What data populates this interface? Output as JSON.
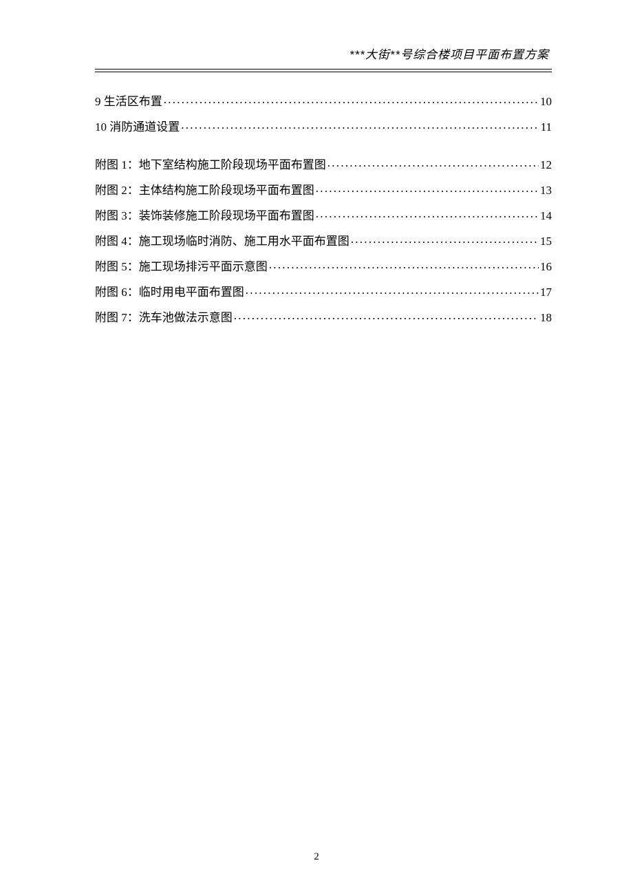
{
  "header": {
    "title": "***大街**号综合楼项目平面布置方案"
  },
  "toc": {
    "sections": [
      {
        "label": "9 生活区布置",
        "page": "10"
      },
      {
        "label": "10 消防通道设置",
        "page": "11"
      }
    ],
    "appendices": [
      {
        "label": "附图 1：地下室结构施工阶段现场平面布置图",
        "page": "12"
      },
      {
        "label": "附图 2：主体结构施工阶段现场平面布置图",
        "page": "13"
      },
      {
        "label": "附图 3：装饰装修施工阶段现场平面布置图",
        "page": "14"
      },
      {
        "label": "附图 4：施工现场临时消防、施工用水平面布置图",
        "page": "15"
      },
      {
        "label": "附图 5：施工现场排污平面示意图",
        "page": "16"
      },
      {
        "label": "附图 6：临时用电平面布置图",
        "page": "17"
      },
      {
        "label": "附图 7：洗车池做法示意图",
        "page": "18"
      }
    ]
  },
  "pageNumber": "2"
}
